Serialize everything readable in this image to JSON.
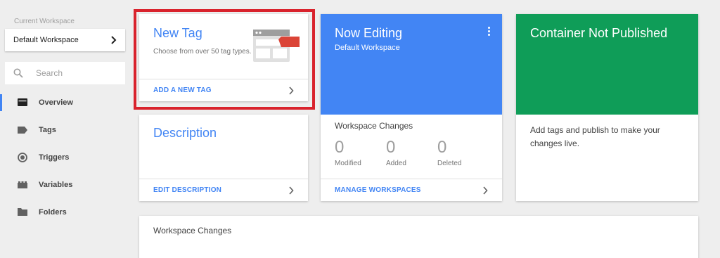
{
  "sidebar": {
    "workspace_label": "Current Workspace",
    "workspace_value": "Default Workspace",
    "search_placeholder": "Search",
    "items": [
      {
        "label": "Overview",
        "icon": "folder-open-icon"
      },
      {
        "label": "Tags",
        "icon": "tag-icon"
      },
      {
        "label": "Triggers",
        "icon": "trigger-icon"
      },
      {
        "label": "Variables",
        "icon": "variables-icon"
      },
      {
        "label": "Folders",
        "icon": "folder-icon"
      }
    ]
  },
  "new_tag": {
    "title": "New Tag",
    "description": "Choose from over 50 tag types.",
    "action": "ADD A NEW TAG"
  },
  "description_card": {
    "title": "Description",
    "action": "EDIT DESCRIPTION"
  },
  "now_editing": {
    "title": "Now Editing",
    "subtitle": "Default Workspace",
    "changes_title": "Workspace Changes",
    "stats": [
      {
        "value": "0",
        "label": "Modified"
      },
      {
        "value": "0",
        "label": "Added"
      },
      {
        "value": "0",
        "label": "Deleted"
      }
    ],
    "action": "MANAGE WORKSPACES"
  },
  "container_status": {
    "title": "Container Not Published",
    "body": "Add tags and publish to make your changes live."
  },
  "workspace_changes": {
    "title": "Workspace Changes"
  },
  "colors": {
    "accent": "#4285f4",
    "published": "#0f9d58",
    "highlight": "#d9232d"
  }
}
